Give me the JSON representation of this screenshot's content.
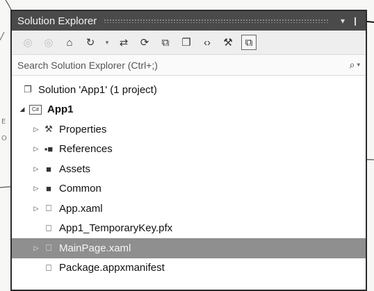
{
  "window": {
    "title": "Solution Explorer",
    "pin_glyph": "▾",
    "pushpin_glyph": "❙"
  },
  "toolbar": {
    "buttons": [
      {
        "name": "back-icon",
        "glyph": "◎"
      },
      {
        "name": "forward-icon",
        "glyph": "◎"
      },
      {
        "name": "home-icon",
        "glyph": "⌂"
      },
      {
        "name": "sync-icon",
        "glyph": "↻"
      },
      {
        "name": "pending-changes-icon",
        "glyph": "⇄"
      },
      {
        "name": "refresh-icon",
        "glyph": "⟳"
      },
      {
        "name": "collapse-all-icon",
        "glyph": "⧉"
      },
      {
        "name": "show-all-files-icon",
        "glyph": "❐"
      },
      {
        "name": "view-code-icon",
        "glyph": "‹›"
      },
      {
        "name": "properties-icon",
        "glyph": "⚒"
      },
      {
        "name": "preview-icon",
        "glyph": "⧉"
      }
    ],
    "dropdown_glyph": "▾"
  },
  "search": {
    "placeholder": "Search Solution Explorer (Ctrl+;)",
    "icon_glyph": "⌕",
    "caret_glyph": "▾"
  },
  "tree": [
    {
      "label": "Solution 'App1' (1 project)",
      "icon": "❐",
      "indent": 0,
      "expander": "",
      "bold": false,
      "selected": false
    },
    {
      "label": "App1",
      "icon": "C#",
      "indent": 0,
      "expander": "◢",
      "bold": true,
      "selected": false
    },
    {
      "label": "Properties",
      "icon": "⚒",
      "indent": 1,
      "expander": "▷",
      "bold": false,
      "selected": false
    },
    {
      "label": "References",
      "icon": "▪■",
      "indent": 1,
      "expander": "▷",
      "bold": false,
      "selected": false
    },
    {
      "label": "Assets",
      "icon": "■",
      "indent": 1,
      "expander": "▷",
      "bold": false,
      "selected": false
    },
    {
      "label": "Common",
      "icon": "■",
      "indent": 1,
      "expander": "▷",
      "bold": false,
      "selected": false
    },
    {
      "label": "App.xaml",
      "icon": "⎕",
      "indent": 1,
      "expander": "▷",
      "bold": false,
      "selected": false
    },
    {
      "label": "App1_TemporaryKey.pfx",
      "icon": "⎕",
      "indent": 1,
      "expander": "",
      "bold": false,
      "selected": false
    },
    {
      "label": "MainPage.xaml",
      "icon": "⎕",
      "indent": 1,
      "expander": "▷",
      "bold": false,
      "selected": true
    },
    {
      "label": "Package.appxmanifest",
      "icon": "⎕",
      "indent": 1,
      "expander": "",
      "bold": false,
      "selected": false
    }
  ],
  "annotations": {
    "margin_text_1": "E",
    "margin_text_2": "O"
  }
}
